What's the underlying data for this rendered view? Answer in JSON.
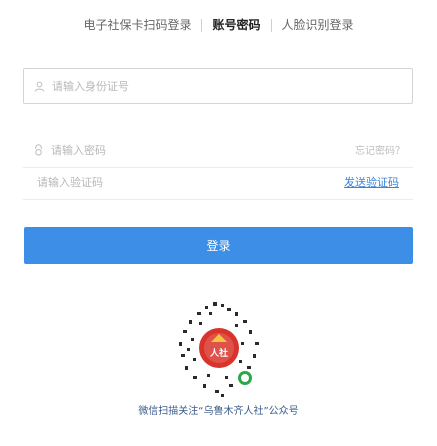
{
  "tabs": [
    {
      "label": "电子社保卡扫码登录",
      "active": false
    },
    {
      "label": "账号密码",
      "active": true
    },
    {
      "label": "人脸识别登录",
      "active": false
    }
  ],
  "form": {
    "id_placeholder": "请输入身份证号",
    "password_placeholder": "请输入密码",
    "forgot_password": "忘记密码？",
    "captcha_placeholder": "请输入验证码",
    "get_captcha": "发送验证码",
    "login_label": "登录"
  },
  "qr": {
    "caption": "微信扫描关注“乌鲁木齐人社”公众号",
    "logo_text": "人社"
  },
  "colors": {
    "primary": "#3d8ee6",
    "link": "#3a84d6"
  }
}
